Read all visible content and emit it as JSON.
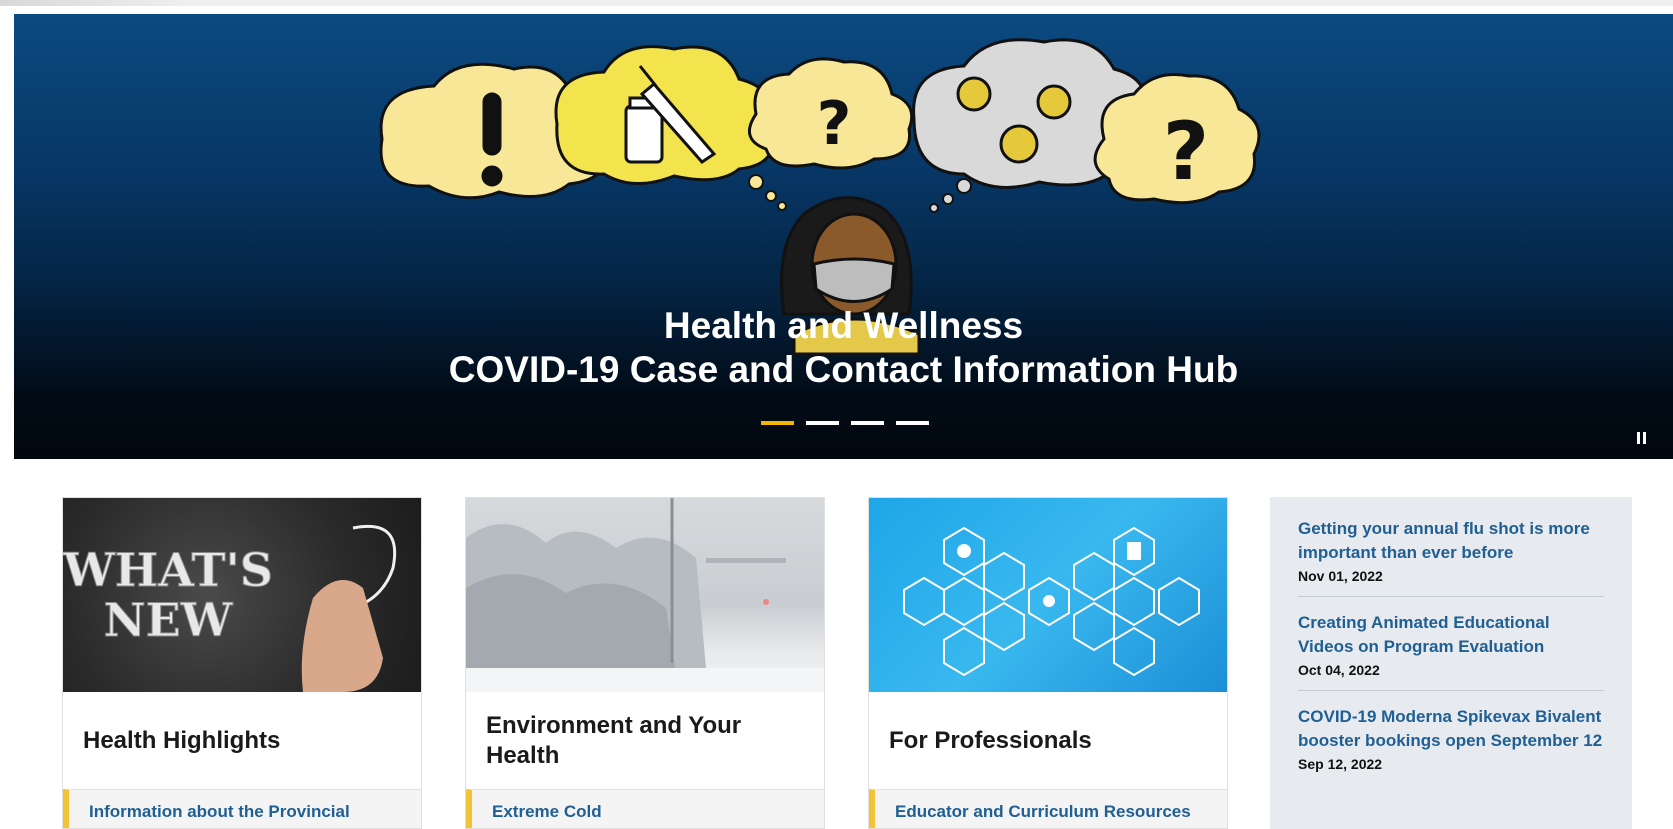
{
  "hero": {
    "title": "Health and Wellness",
    "subtitle": "COVID-19 Case and Contact Information Hub",
    "slide_count": 4,
    "active_slide": 0,
    "accent_color": "#f2b705"
  },
  "cards": [
    {
      "image_text_line1": "WHAT'S",
      "image_text_line2": "NEW",
      "title": "Health Highlights",
      "link": "Information about the Provincial"
    },
    {
      "title": "Environment and Your Health",
      "link": "Extreme Cold"
    },
    {
      "title": "For Professionals",
      "link": "Educator and Curriculum Resources"
    }
  ],
  "news": [
    {
      "title": "Getting your annual flu shot is more important than ever before",
      "date": "Nov 01, 2022"
    },
    {
      "title": "Creating Animated Educational Videos on Program Evaluation",
      "date": "Oct 04, 2022"
    },
    {
      "title": "COVID-19 Moderna Spikevax Bivalent booster bookings open September 12",
      "date": "Sep 12, 2022"
    }
  ],
  "colors": {
    "link_blue": "#1f5f93",
    "accent_yellow": "#f2c335",
    "hero_blue": "#0b4a80",
    "news_bg": "#e7ebef"
  }
}
